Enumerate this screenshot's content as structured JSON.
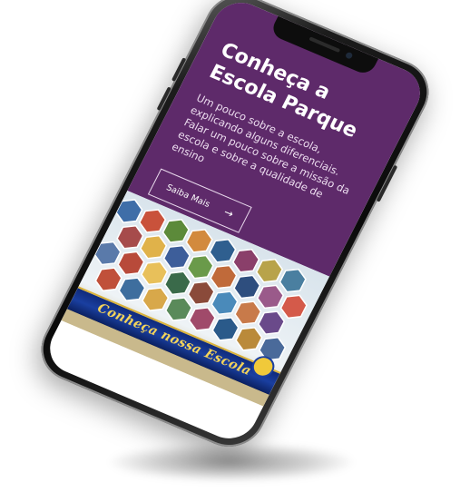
{
  "hero": {
    "title": "Conheça a Escola Parque",
    "text": "Um pouco sobre a escola, explicando alguns diferenciais. Falar um pouco sobre a missão da escola e sobre a qualidade de ensino",
    "button_label": "Saiba Mais",
    "button_icon": "arrow-right-icon",
    "background_color": "#5e2a6a"
  },
  "banner": {
    "caption": "Conheça nossa Escola",
    "caption_color": "#f3d35a",
    "strip_color": "#1a3fa0"
  },
  "device": {
    "frame_color": "#0a0a0a"
  }
}
